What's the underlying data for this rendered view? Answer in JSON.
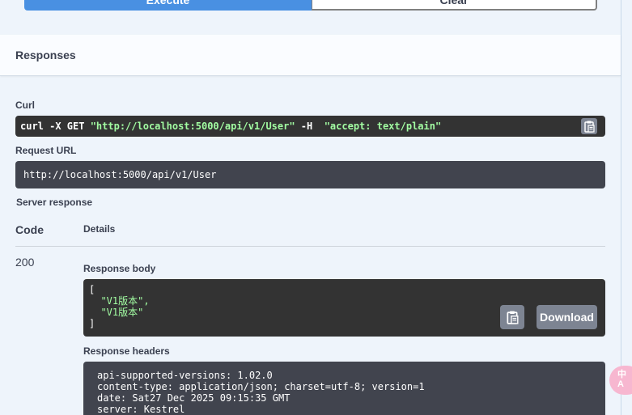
{
  "top_buttons": {
    "execute": "Execute",
    "clear": "Clear"
  },
  "responses_title": "Responses",
  "curl": {
    "label": "Curl",
    "cmd_prefix": "curl -X GET ",
    "url_quoted": "\"http://localhost:5000/api/v1/User\"",
    "flag": " -H  ",
    "header_quoted": "\"accept: text/plain\""
  },
  "request_url": {
    "label": "Request URL",
    "value": "http://localhost:5000/api/v1/User"
  },
  "server_response_label": "Server response",
  "table": {
    "code_header": "Code",
    "details_header": "Details"
  },
  "response": {
    "code": "200",
    "body_label": "Response body",
    "body_open": "[",
    "body_items": [
      "  \"V1版本\",",
      "  \"V1版本\""
    ],
    "body_close": "]",
    "download_label": "Download",
    "headers_label": "Response headers",
    "headers": [
      "api-supported-versions: 1.02.0",
      "content-type: application/json; charset=utf-8; version=1",
      "date: Sat27 Dec 2025 09:15:35 GMT",
      "server: Kestrel"
    ]
  },
  "translate_bubble": {
    "line1": "中",
    "line2": "A"
  },
  "colors": {
    "execute_blue": "#4990e2",
    "code_bg": "#333333",
    "string_green": "#a2fca2",
    "url_bg": "#41444e",
    "button_gray": "#7d8492"
  },
  "icons": {
    "copy": "clipboard-icon"
  }
}
